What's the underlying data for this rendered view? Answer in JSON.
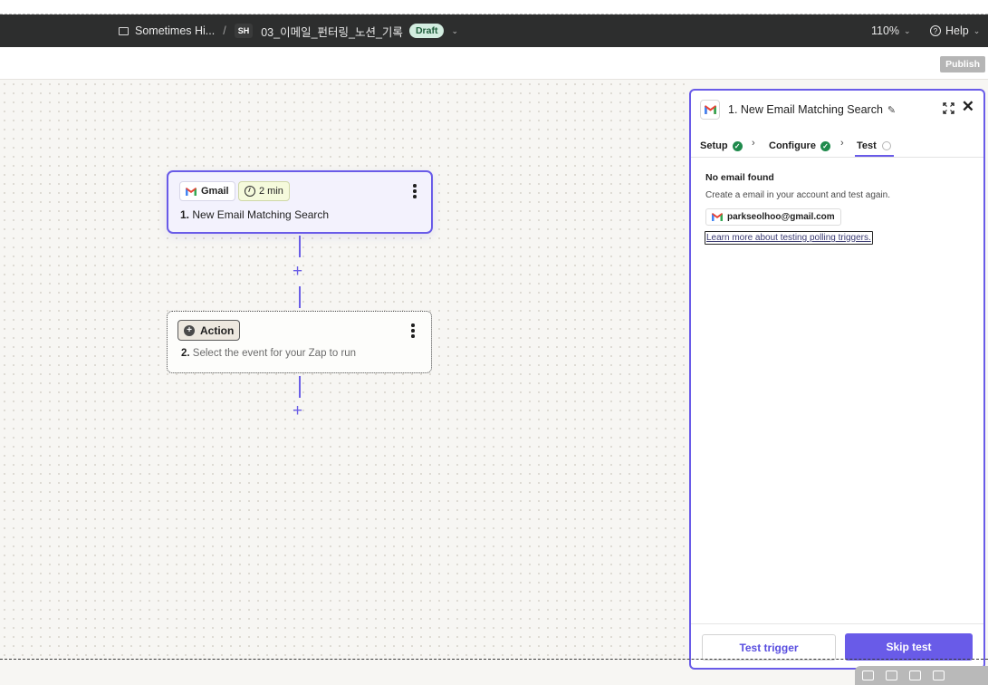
{
  "topbar": {
    "folder_name": "Sometimes Hi...",
    "separator": "/",
    "owner_initials": "SH",
    "zap_name": "03_이메일_펀터링_노션_기록",
    "status_badge": "Draft",
    "zoom": "110%",
    "help_label": "Help"
  },
  "subbar": {
    "publish_label": "Publish"
  },
  "canvas": {
    "step1": {
      "app_label": "Gmail",
      "poll_interval": "2 min",
      "number": "1.",
      "title": "New Email Matching Search"
    },
    "step2": {
      "chip_label": "Action",
      "number": "2.",
      "placeholder": "Select the event for your Zap to run"
    },
    "add_glyph": "+"
  },
  "panel": {
    "title": "1. New Email Matching Search",
    "tabs": [
      {
        "label": "Setup",
        "state": "complete"
      },
      {
        "label": "Configure",
        "state": "complete"
      },
      {
        "label": "Test",
        "state": "current"
      }
    ],
    "tab_separator": "›",
    "message_title": "No email found",
    "message_body": "Create a email in your account and test again.",
    "account_email": "parkseolhoo@gmail.com",
    "help_link": "Learn more about testing polling triggers.",
    "test_button": "Test trigger",
    "skip_button": "Skip test"
  },
  "colors": {
    "accent": "#695be8",
    "topbar_bg": "#2d2e2e",
    "success": "#1f8a4c",
    "draft_badge_bg": "#d3ede0"
  },
  "icons": [
    "folder-icon",
    "chevron-down-icon",
    "help-icon",
    "gmail-icon",
    "clock-icon",
    "kebab-menu-icon",
    "plus-icon",
    "pencil-icon",
    "expand-icon",
    "close-icon",
    "check-icon"
  ]
}
